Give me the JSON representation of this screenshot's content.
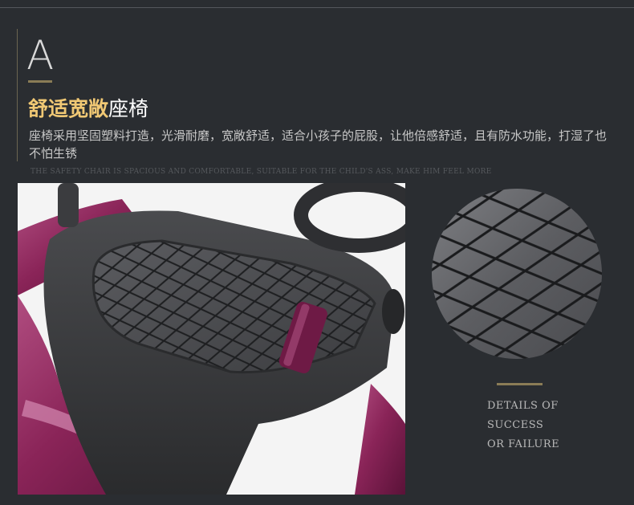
{
  "section_letter": "A",
  "heading": {
    "highlight": "舒适宽敞",
    "rest": "座椅"
  },
  "description": "座椅采用坚固塑料打造，光滑耐磨，宽敞舒适，适合小孩子的屁股，让他倍感舒适，且有防水功能，打湿了也不怕生锈",
  "english_caption": "THE SAFETY CHAIR IS SPACIOUS AND COMFORTABLE, SUITABLE FOR THE CHILD'S ASS, MAKE HIM FEEL MORE",
  "details": [
    "DETAILS OF",
    "SUCCESS",
    "OR FAILURE"
  ],
  "colors": {
    "background": "#2a2d31",
    "accent_gold": "#f0c874",
    "divider_gold": "#8a7c56",
    "car_body": "#8e2a5e",
    "seat": "#3a3b3e"
  }
}
